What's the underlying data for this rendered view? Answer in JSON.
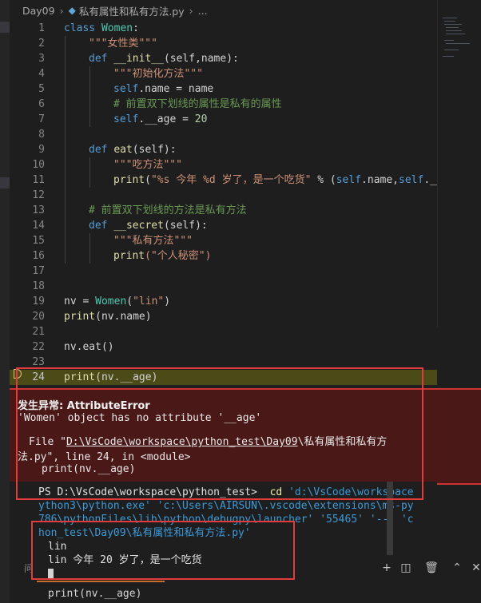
{
  "breadcrumb": {
    "folder": "Day09",
    "file": "私有属性和私有方法.py",
    "more": "..."
  },
  "code_lines": [
    {
      "n": "1"
    },
    {
      "n": "2"
    },
    {
      "n": "3"
    },
    {
      "n": "4"
    },
    {
      "n": "5"
    },
    {
      "n": "6"
    },
    {
      "n": "7"
    },
    {
      "n": "8"
    },
    {
      "n": "9"
    },
    {
      "n": "10"
    },
    {
      "n": "11"
    },
    {
      "n": "12"
    },
    {
      "n": "13"
    },
    {
      "n": "14"
    },
    {
      "n": "15"
    },
    {
      "n": "16"
    },
    {
      "n": "17"
    },
    {
      "n": "18"
    },
    {
      "n": "19"
    },
    {
      "n": "20"
    },
    {
      "n": "21"
    },
    {
      "n": "22"
    },
    {
      "n": "23"
    },
    {
      "n": "24"
    }
  ],
  "code": {
    "l1_kw": "class",
    "l1_cls": "Women",
    "l1_end": ":",
    "l2": "\"\"\"女性类\"\"\"",
    "l3_kw": "def",
    "l3_fn": "__init__",
    "l3_args": "(self,name):",
    "l4": "\"\"\"初始化方法\"\"\"",
    "l5_self": "self",
    "l5_rest": ".name = name",
    "l6": "# 前置双下划线的属性是私有的属性",
    "l7_self": "self",
    "l7_rest": ".__age = ",
    "l7_num": "20",
    "l9_kw": "def",
    "l9_fn": "eat",
    "l9_args": "(self):",
    "l10": "\"\"\"吃方法\"\"\"",
    "l11_fn": "print",
    "l11_open": "(",
    "l11_str": "\"%s 今年 %d 岁了，是一个吃货\"",
    "l11_rest": " % (",
    "l11_self1": "self",
    "l11_mid": ".name,",
    "l11_self2": "self",
    "l11_tail": ".__",
    "l13": "# 前置双下划线的方法是私有方法",
    "l14_kw": "def",
    "l14_fn": "__secret",
    "l14_args": "(self):",
    "l15": "\"\"\"私有方法\"\"\"",
    "l16_fn": "print",
    "l16_str": "(\"个人秘密\")",
    "l19_var": "nv",
    "l19_eq": " = ",
    "l19_cls": "Women",
    "l19_open": "(",
    "l19_str": "\"lin\"",
    "l19_close": ")",
    "l20_fn": "print",
    "l20_rest": "(nv.name)",
    "l22": "nv.eat()",
    "l24_fn": "print",
    "l24_rest": "(nv.__age)"
  },
  "exception": {
    "title": "发生异常: AttributeError",
    "message": "'Women' object has no attribute '__age'",
    "trace_prefix": "File \"",
    "trace_path": "D:\\VsCode\\workspace\\python_test\\Day09",
    "trace_path_cont": "\\私有属性和私有方",
    "trace_line2": "法.py\", line 24, in <module>",
    "trace_code": "print(nv.__age)"
  },
  "terminal": {
    "line1_ps": "PS D:\\VsCode\\workspace\\python_test> ",
    "line1_cmd": " cd ",
    "line1_arg": "'d:\\VsCode\\workspace",
    "line2": "ython3\\python.exe' 'c:\\Users\\AIRSUN\\.vscode\\extensions\\ms-py",
    "line3": "786\\pythonFiles\\lib\\python\\debugpy\\launcher' '55465' '--' 'c",
    "line4": "hon_test\\Day09\\私有属性和私有方法.py'",
    "line5": "lin",
    "line6": "lin 今年 20 岁了，是一个吃货"
  },
  "panel": {
    "tab_label": "问"
  },
  "bottom_code": "print(nv.__age)",
  "colors": {
    "exception_bg": "#4b1818",
    "highlight_line": "#4b4b18",
    "annotation_red": "#e23b3b"
  }
}
